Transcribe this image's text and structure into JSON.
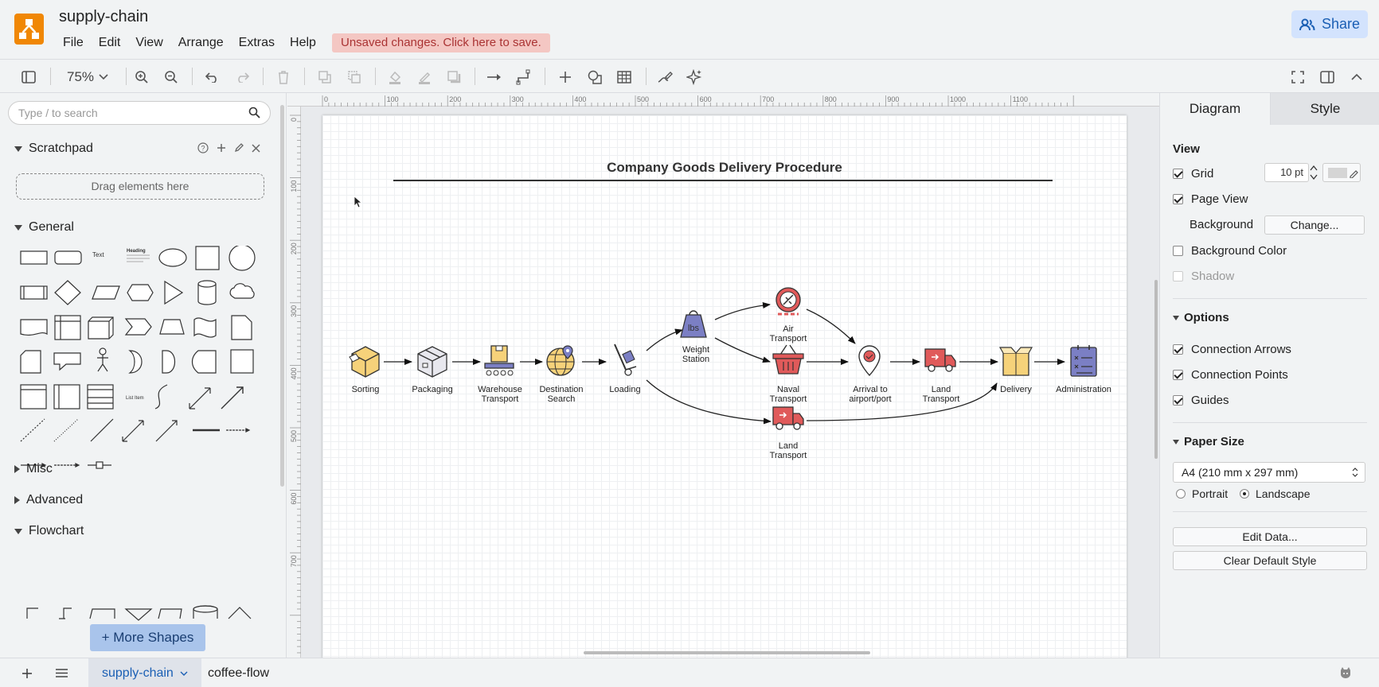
{
  "app": {
    "title": "supply-chain",
    "unsaved_notice": "Unsaved changes. Click here to save.",
    "share_label": "Share"
  },
  "menu": [
    "File",
    "Edit",
    "View",
    "Arrange",
    "Extras",
    "Help"
  ],
  "toolbar": {
    "zoom": "75%"
  },
  "left_panel": {
    "search_placeholder": "Type / to search",
    "scratchpad": {
      "title": "Scratchpad",
      "drop_label": "Drag elements here"
    },
    "sections": {
      "general": "General",
      "misc": "Misc",
      "advanced": "Advanced",
      "flowchart": "Flowchart"
    },
    "shape_text": {
      "text": "Text",
      "heading": "Heading",
      "list_item": "List Item"
    },
    "more_shapes": "+ More Shapes"
  },
  "ruler": {
    "top": [
      "0",
      "100",
      "200",
      "300",
      "400",
      "500",
      "600",
      "700",
      "800",
      "900",
      "1000",
      "1100"
    ],
    "left": [
      "0",
      "100",
      "200",
      "300",
      "400",
      "500",
      "600",
      "700"
    ]
  },
  "diagram": {
    "title": "Company Goods Delivery Procedure",
    "nodes": {
      "sorting": "Sorting",
      "packaging": "Packaging",
      "warehouse": "Warehouse\nTransport",
      "destination": "Destination\nSearch",
      "loading": "Loading",
      "weight": "Weight\nStation",
      "air": "Air\nTransport",
      "naval": "Naval\nTransport",
      "land_bottom": "Land\nTransport",
      "arrival": "Arrival to\nairport/port",
      "land": "Land\nTransport",
      "delivery": "Delivery",
      "administration": "Administration"
    },
    "weight_tag": "lbs"
  },
  "right_panel": {
    "tabs": [
      "Diagram",
      "Style"
    ],
    "view_heading": "View",
    "grid": {
      "label": "Grid",
      "value": "10 pt",
      "checked": true
    },
    "page_view": {
      "label": "Page View",
      "checked": true
    },
    "background": {
      "label": "Background",
      "button": "Change..."
    },
    "background_color": {
      "label": "Background Color",
      "checked": false
    },
    "shadow": {
      "label": "Shadow",
      "checked": false
    },
    "options_heading": "Options",
    "options": [
      {
        "label": "Connection Arrows",
        "checked": true
      },
      {
        "label": "Connection Points",
        "checked": true
      },
      {
        "label": "Guides",
        "checked": true
      }
    ],
    "paper_heading": "Paper Size",
    "paper_size": "A4 (210 mm x 297 mm)",
    "orientation": {
      "portrait": "Portrait",
      "landscape": "Landscape",
      "selected": "Landscape"
    },
    "edit_data": "Edit Data...",
    "clear_style": "Clear Default Style"
  },
  "footer": {
    "pages": [
      "supply-chain",
      "coffee-flow"
    ],
    "active_page": "supply-chain"
  },
  "colors": {
    "accent": "#1a5fb4",
    "logo": "#f08705",
    "unsaved_bg": "#f4c7c3",
    "icon_purple": "#7b7fc4",
    "icon_red": "#e05a5a",
    "icon_yellow": "#f6d27a"
  }
}
